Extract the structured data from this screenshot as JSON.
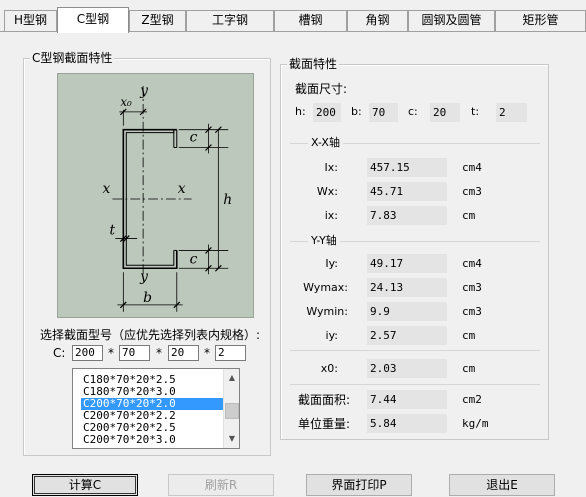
{
  "tabs": [
    "H型钢",
    "C型钢",
    "Z型钢",
    "工字钢",
    "槽钢",
    "角钢",
    "圆钢及圆管",
    "矩形管"
  ],
  "left_group": {
    "title": "C型钢截面特性",
    "select_label": "选择截面型号（应优先选择列表内规格）:",
    "c_label": "C:",
    "inputs": [
      "200",
      "70",
      "20",
      "2"
    ],
    "separator": "*"
  },
  "figure_labels": {
    "y_top": "y",
    "x0": "x₀",
    "c_top": "c",
    "x_left": "x",
    "x_right": "x",
    "h": "h",
    "t": "t",
    "c_bottom": "c",
    "y_bottom": "y",
    "b": "b"
  },
  "list": {
    "items": [
      "C180*70*20*2.5",
      "C180*70*20*3.0",
      "C200*70*20*2.0",
      "C200*70*20*2.2",
      "C200*70*20*2.5",
      "C200*70*20*3.0"
    ],
    "selected_index": 2
  },
  "right_group": {
    "title": "截面特性",
    "dims_title": "截面尺寸:",
    "dims": [
      {
        "label": "h:",
        "value": "200"
      },
      {
        "label": "b:",
        "value": "70"
      },
      {
        "label": "c:",
        "value": "20"
      },
      {
        "label": "t:",
        "value": "2"
      }
    ],
    "xx_title": "X-X轴",
    "xx": [
      {
        "label": "Ix:",
        "value": "457.15",
        "unit": "cm4"
      },
      {
        "label": "Wx:",
        "value": "45.71",
        "unit": "cm3"
      },
      {
        "label": "ix:",
        "value": "7.83",
        "unit": "cm"
      }
    ],
    "yy_title": "Y-Y轴",
    "yy": [
      {
        "label": "Iy:",
        "value": "49.17",
        "unit": "cm4"
      },
      {
        "label": "Wymax:",
        "value": "24.13",
        "unit": "cm3"
      },
      {
        "label": "Wymin:",
        "value": "9.9",
        "unit": "cm3"
      },
      {
        "label": "iy:",
        "value": "2.57",
        "unit": "cm"
      }
    ],
    "x0": {
      "label": "x0:",
      "value": "2.03",
      "unit": "cm"
    },
    "area": {
      "label": "截面面积:",
      "value": "7.44",
      "unit": "cm2"
    },
    "weight": {
      "label": "单位重量:",
      "value": "5.84",
      "unit": "kg/m"
    }
  },
  "buttons": {
    "calc": "计算C",
    "refresh": "刷新R",
    "print": "界面打印P",
    "exit": "退出E"
  },
  "colors": {
    "figure_bg": "#bcc8bc",
    "selection": "#3399ff",
    "value_bg": "#e4e4e4"
  }
}
